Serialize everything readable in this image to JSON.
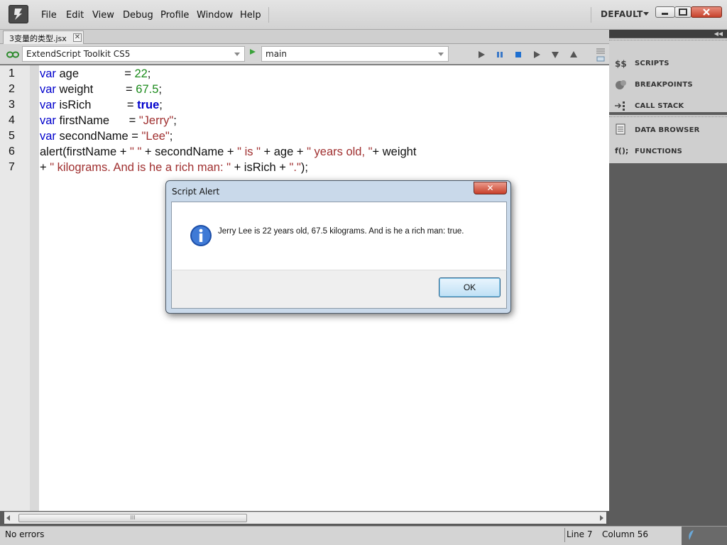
{
  "menu": [
    "File",
    "Edit",
    "View",
    "Debug",
    "Profile",
    "Window",
    "Help"
  ],
  "workspace": "DEFAULT",
  "document_tab": {
    "label": "3变量的类型.jsx",
    "close": "✕"
  },
  "toolbar": {
    "target_app": "ExtendScript Toolkit CS5",
    "engine": "main"
  },
  "editor": {
    "line_numbers": [
      "1",
      "2",
      "3",
      "4",
      "5",
      "6",
      "7"
    ],
    "lines": [
      [
        {
          "t": "var",
          "c": "kw"
        },
        {
          "t": " age              = ",
          "c": ""
        },
        {
          "t": "22",
          "c": "num"
        },
        {
          "t": ";",
          "c": ""
        }
      ],
      [
        {
          "t": "var",
          "c": "kw"
        },
        {
          "t": " weight          = ",
          "c": ""
        },
        {
          "t": "67.5",
          "c": "num"
        },
        {
          "t": ";",
          "c": ""
        }
      ],
      [
        {
          "t": "var",
          "c": "kw"
        },
        {
          "t": " isRich           = ",
          "c": ""
        },
        {
          "t": "true",
          "c": "bool"
        },
        {
          "t": ";",
          "c": ""
        }
      ],
      [
        {
          "t": "var",
          "c": "kw"
        },
        {
          "t": " firstName      = ",
          "c": ""
        },
        {
          "t": "\"Jerry\"",
          "c": "str"
        },
        {
          "t": ";",
          "c": ""
        }
      ],
      [
        {
          "t": "var",
          "c": "kw"
        },
        {
          "t": " secondName = ",
          "c": ""
        },
        {
          "t": "\"Lee\"",
          "c": "str"
        },
        {
          "t": ";",
          "c": ""
        }
      ],
      [
        {
          "t": "alert(firstName + ",
          "c": ""
        },
        {
          "t": "\" \"",
          "c": "str"
        },
        {
          "t": " + secondName + ",
          "c": ""
        },
        {
          "t": "\" is \"",
          "c": "str"
        },
        {
          "t": " + age + ",
          "c": ""
        },
        {
          "t": "\" years old, \"",
          "c": "str"
        },
        {
          "t": "+ weight",
          "c": ""
        }
      ],
      [
        {
          "t": "+ ",
          "c": ""
        },
        {
          "t": "\" kilograms. And is he a rich man: \"",
          "c": "str"
        },
        {
          "t": " + isRich + ",
          "c": ""
        },
        {
          "t": "\".\"",
          "c": "str"
        },
        {
          "t": ");",
          "c": ""
        }
      ]
    ]
  },
  "scrollbar": {
    "grip": "III"
  },
  "status": {
    "message": "No errors",
    "line": "Line 7",
    "column": "Column 56"
  },
  "panels": {
    "debug": [
      {
        "label": "SCRIPTS",
        "icon": "scripts-icon"
      },
      {
        "label": "BREAKPOINTS",
        "icon": "breakpoints-icon"
      },
      {
        "label": "CALL STACK",
        "icon": "call-stack-icon"
      }
    ],
    "data": [
      {
        "label": "DATA BROWSER",
        "icon": "data-browser-icon"
      },
      {
        "label": "FUNCTIONS",
        "icon": "functions-icon",
        "glyph": "f();"
      }
    ]
  },
  "alert": {
    "title": "Script Alert",
    "close": "✕",
    "message": "Jerry Lee is 22 years old, 67.5 kilograms. And is he a rich man: true.",
    "ok": "OK"
  }
}
